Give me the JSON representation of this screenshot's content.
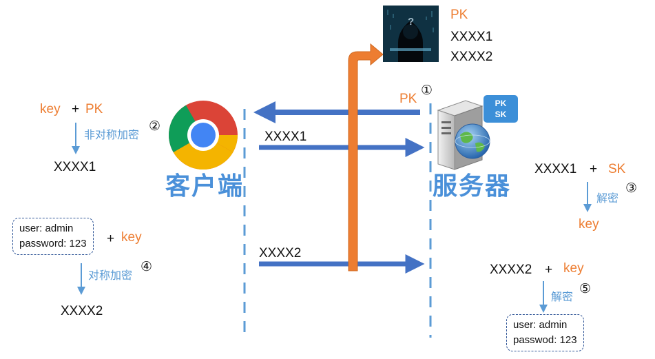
{
  "client": {
    "title": "客户端",
    "step2": {
      "key": "key",
      "plus": "+",
      "pk": "PK",
      "action": "非对称加密",
      "num": "②",
      "result": "XXXX1"
    },
    "step4": {
      "user_line": "user: admin",
      "password_line": "password: 123",
      "plus": "+",
      "key": "key",
      "action": "对称加密",
      "num": "④",
      "result": "XXXX2"
    }
  },
  "server": {
    "title": "服务器",
    "badge": {
      "pk": "PK",
      "sk": "SK"
    },
    "step3": {
      "xxxx1": "XXXX1",
      "plus": "+",
      "sk": "SK",
      "action": "解密",
      "num": "③",
      "result": "key"
    },
    "step5": {
      "xxxx2": "XXXX2",
      "plus": "+",
      "key": "key",
      "action": "解密",
      "num": "⑤",
      "user_line": "user: admin",
      "password_line": "passwod: 123"
    }
  },
  "channel": {
    "pk_label": "PK",
    "step1_num": "①",
    "msg1": "XXXX1",
    "msg2": "XXXX2"
  },
  "attacker": {
    "pk": "PK",
    "x1": "XXXX1",
    "x2": "XXXX2",
    "mark": "?"
  },
  "colors": {
    "arrow_blue": "#4472C4",
    "intercept_orange": "#ED7D31",
    "text_orange": "#ED7D31",
    "text_blue": "#5B9BD5",
    "dash_blue": "#5B9BD5"
  }
}
